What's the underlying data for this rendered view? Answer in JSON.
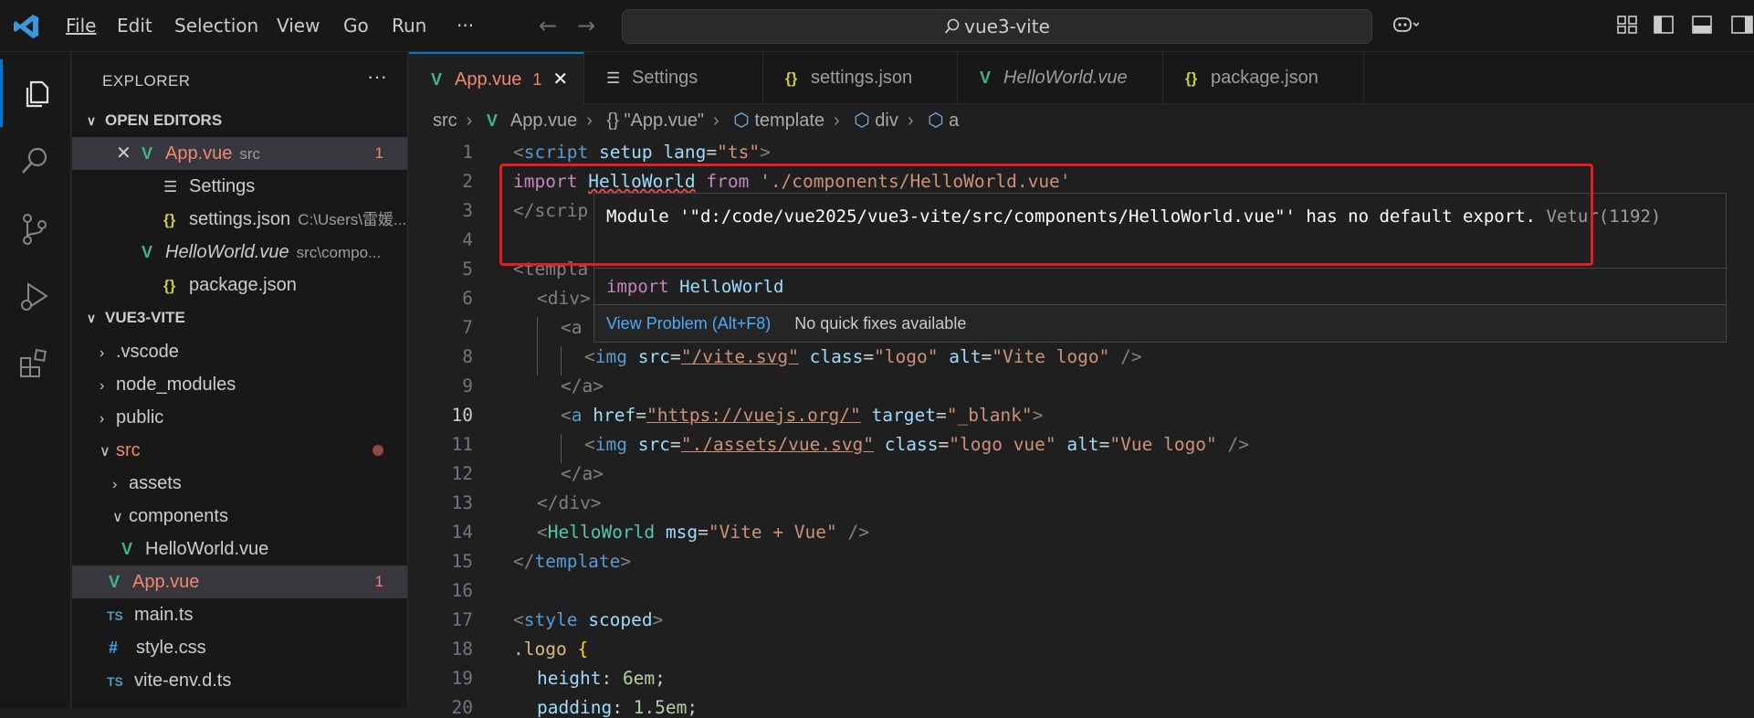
{
  "menu": [
    "File",
    "Edit",
    "Selection",
    "View",
    "Go",
    "Run",
    "···"
  ],
  "command_center": "vue3-vite",
  "sidebar": {
    "title": "EXPLORER",
    "open_editors": {
      "label": "OPEN EDITORS",
      "items": [
        {
          "name": "App.vue",
          "desc": "src",
          "badge": "1"
        },
        {
          "name": "Settings",
          "desc": ""
        },
        {
          "name": "settings.json",
          "desc": "C:\\Users\\雷媛..."
        },
        {
          "name": "HelloWorld.vue",
          "desc": "src\\compo..."
        },
        {
          "name": "package.json",
          "desc": ""
        }
      ]
    },
    "project": {
      "label": "VUE3-VITE",
      "items": [
        {
          "name": ".vscode"
        },
        {
          "name": "node_modules"
        },
        {
          "name": "public"
        },
        {
          "name": "src"
        },
        {
          "name": "assets"
        },
        {
          "name": "components"
        },
        {
          "name": "HelloWorld.vue"
        },
        {
          "name": "App.vue",
          "badge": "1"
        },
        {
          "name": "main.ts",
          "icon": "TS"
        },
        {
          "name": "style.css",
          "icon": "#"
        },
        {
          "name": "vite-env.d.ts",
          "icon": "TS"
        }
      ]
    }
  },
  "tabs": [
    {
      "label": "App.vue",
      "badge": "1"
    },
    {
      "label": "Settings"
    },
    {
      "label": "settings.json"
    },
    {
      "label": "HelloWorld.vue"
    },
    {
      "label": "package.json"
    }
  ],
  "breadcrumb": [
    "src",
    "App.vue",
    "{} \"App.vue\"",
    "template",
    "div",
    "a"
  ],
  "code": {
    "line_numbers": [
      "1",
      "2",
      "3",
      "4",
      "5",
      "6",
      "7",
      "8",
      "9",
      "10",
      "11",
      "12",
      "13",
      "14",
      "15",
      "16",
      "17",
      "18",
      "19",
      "20"
    ],
    "l1": {
      "open": "<",
      "tag": "script",
      "attr1": "setup",
      "attr2": "lang",
      "eq": "=",
      "val": "\"ts\"",
      "close": ">"
    },
    "l2": {
      "import": "import",
      "name": "HelloWorld",
      "from": "from",
      "path": "'./components/HelloWorld.vue'"
    },
    "l3": {
      "text": "</scrip"
    },
    "l5": {
      "text": "<templa"
    },
    "l6": {
      "text": "<div>"
    },
    "l7": {
      "text": "<a"
    },
    "l8": {
      "tag": "img",
      "a1": "src",
      "v1": "\"/vite.svg\"",
      "a2": "class",
      "v2": "\"logo\"",
      "a3": "alt",
      "v3": "\"Vite logo\"",
      "end": " />"
    },
    "l9": {
      "text": "</a>"
    },
    "l10": {
      "tag": "a",
      "a1": "href",
      "v1": "\"https://vuejs.org/\"",
      "a2": "target",
      "v2": "\"_blank\""
    },
    "l11": {
      "tag": "img",
      "a1": "src",
      "v1": "\"./assets/vue.svg\"",
      "a2": "class",
      "v2": "\"logo vue\"",
      "a3": "alt",
      "v3": "\"Vue logo\"",
      "end": " />"
    },
    "l12": {
      "text": "</a>"
    },
    "l13": {
      "text": "</div>"
    },
    "l14": {
      "comp": "HelloWorld",
      "attr": "msg",
      "val": "\"Vite + Vue\"",
      "end": " />"
    },
    "l15": {
      "tag": "template"
    },
    "l17": {
      "tag": "style",
      "attr": "scoped"
    },
    "l18": {
      "sel": ".logo",
      "brace": " {"
    },
    "l19": {
      "prop": "height",
      "val": "6em"
    },
    "l20": {
      "prop": "padding",
      "val": "1.5em"
    }
  },
  "hover": {
    "message": "Module '\"d:/code/vue2025/vue3-vite/src/components/HelloWorld.vue\"' has no default export.",
    "source": "Vetur(1192)",
    "sig_kw": "import",
    "sig_name": "HelloWorld",
    "view_problem": "View Problem (Alt+F8)",
    "no_fixes": "No quick fixes available"
  }
}
